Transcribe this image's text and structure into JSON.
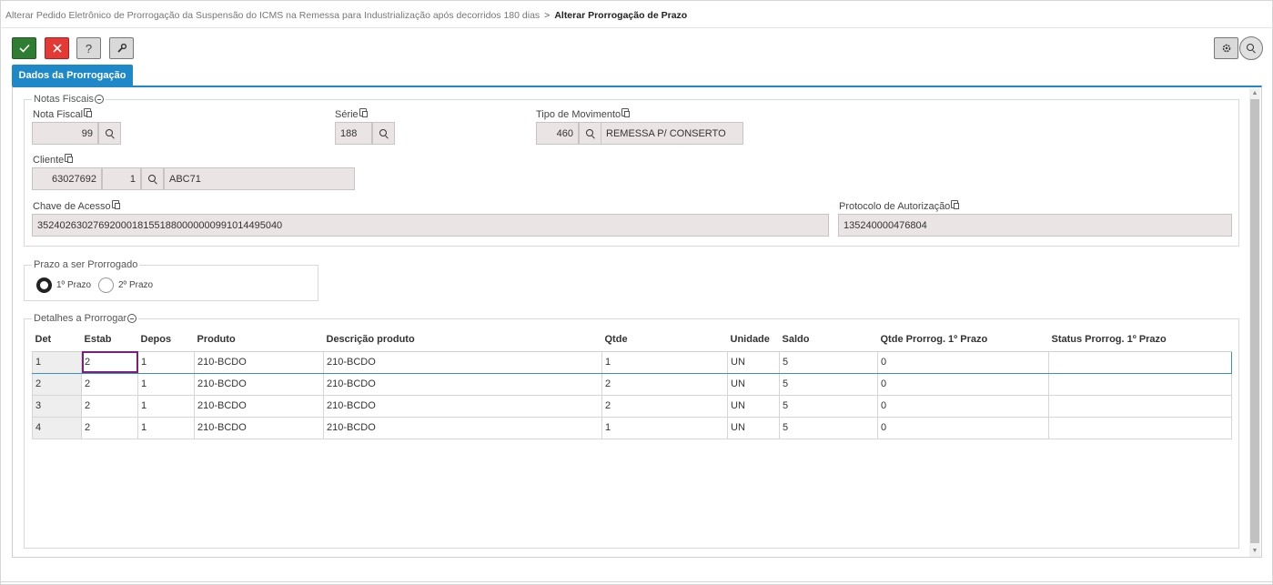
{
  "breadcrumb": {
    "parent": "Alterar Pedido Eletrônico de Prorrogação da Suspensão do ICMS na Remessa para Industrialização após decorridos 180 dias",
    "separator": ">",
    "current": "Alterar Prorrogação de Prazo"
  },
  "toolbar": {
    "ok_icon": "✓",
    "cancel_icon": "✕",
    "help_icon": "?",
    "tool_icon": "wrench-icon",
    "settings_icon": "gear-icon",
    "search_icon": "search-icon"
  },
  "tab": {
    "label": "Dados da Prorrogação"
  },
  "notas": {
    "legend": "Notas Fiscais",
    "nota_fiscal_label": "Nota Fiscal",
    "nota_fiscal_value": "99",
    "serie_label": "Série",
    "serie_value": "188",
    "tipo_mov_label": "Tipo de Movimento",
    "tipo_mov_code": "460",
    "tipo_mov_desc": "REMESSA P/ CONSERTO",
    "cliente_label": "Cliente",
    "cliente_code": "63027692",
    "cliente_seq": "1",
    "cliente_name": "ABC71",
    "chave_label": "Chave de Acesso",
    "chave_value": "35240263027692000181551880000000991014495040",
    "protocolo_label": "Protocolo de Autorização",
    "protocolo_value": "135240000476804"
  },
  "prazo": {
    "legend": "Prazo a ser Prorrogado",
    "option1": "1º Prazo",
    "option2": "2º Prazo",
    "selected": "1º Prazo"
  },
  "detalhes": {
    "legend": "Detalhes a Prorrogar",
    "columns": [
      "Det",
      "Estab",
      "Depos",
      "Produto",
      "Descrição produto",
      "Qtde",
      "Unidade",
      "Saldo",
      "Qtde Prorrog. 1º Prazo",
      "Status Prorrog. 1º Prazo"
    ],
    "rows": [
      [
        "1",
        "2",
        "1",
        "210-BCDO",
        "210-BCDO",
        "1",
        "UN",
        "5",
        "0",
        ""
      ],
      [
        "2",
        "2",
        "1",
        "210-BCDO",
        "210-BCDO",
        "2",
        "UN",
        "5",
        "0",
        ""
      ],
      [
        "3",
        "2",
        "1",
        "210-BCDO",
        "210-BCDO",
        "2",
        "UN",
        "5",
        "0",
        ""
      ],
      [
        "4",
        "2",
        "1",
        "210-BCDO",
        "210-BCDO",
        "1",
        "UN",
        "5",
        "0",
        ""
      ]
    ]
  }
}
